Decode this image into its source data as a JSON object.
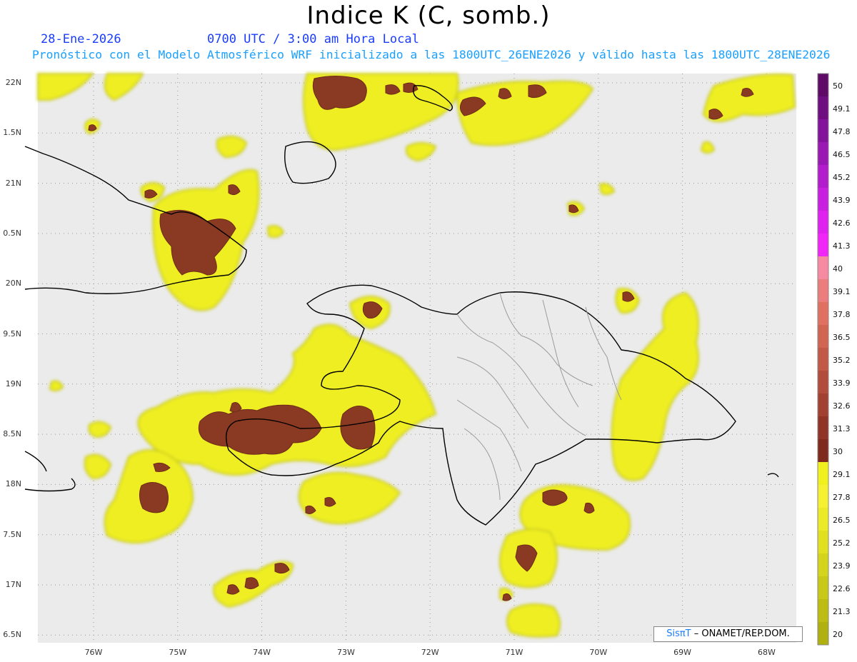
{
  "header": {
    "title": "Indice K (C, somb.)",
    "date": "28-Ene-2026",
    "time": "0700 UTC / 3:00 am Hora Local",
    "subtitle": "Pronóstico con el Modelo Atmosférico WRF inicializado a las 1800UTC_26ENE2026 y válido hasta las  1800UTC_28ENE2026"
  },
  "axes": {
    "lat_ticks": [
      "22N",
      "1.5N",
      "21N",
      "0.5N",
      "20N",
      "9.5N",
      "19N",
      "8.5N",
      "18N",
      "7.5N",
      "17N",
      "6.5N"
    ],
    "lon_ticks": [
      "76W",
      "75W",
      "74W",
      "73W",
      "72W",
      "71W",
      "70W",
      "69W",
      "68W"
    ]
  },
  "colorbar": {
    "labels": [
      "50",
      "49.1",
      "47.8",
      "46.5",
      "45.2",
      "43.9",
      "42.6",
      "41.3",
      "40",
      "39.1",
      "37.8",
      "36.5",
      "35.2",
      "33.9",
      "32.6",
      "31.3",
      "30",
      "29.1",
      "27.8",
      "26.5",
      "25.2",
      "23.9",
      "22.6",
      "21.3",
      "20"
    ],
    "colors": [
      "#5e0a66",
      "#6f0e80",
      "#83139a",
      "#9a18b4",
      "#b21ccc",
      "#c91fe0",
      "#df22ee",
      "#f026f8",
      "#f58aa0",
      "#ec7d7d",
      "#e07060",
      "#d26452",
      "#c25846",
      "#b24c3c",
      "#a24032",
      "#913428",
      "#7e2a1c",
      "#f0f01e",
      "#f5f032",
      "#eaea28",
      "#e0e020",
      "#d4d41c",
      "#c8c818",
      "#bcbc14",
      "#b0b010"
    ]
  },
  "credit": {
    "brand": "SisπT",
    "text": " – ONAMET/REP.DOM."
  }
}
